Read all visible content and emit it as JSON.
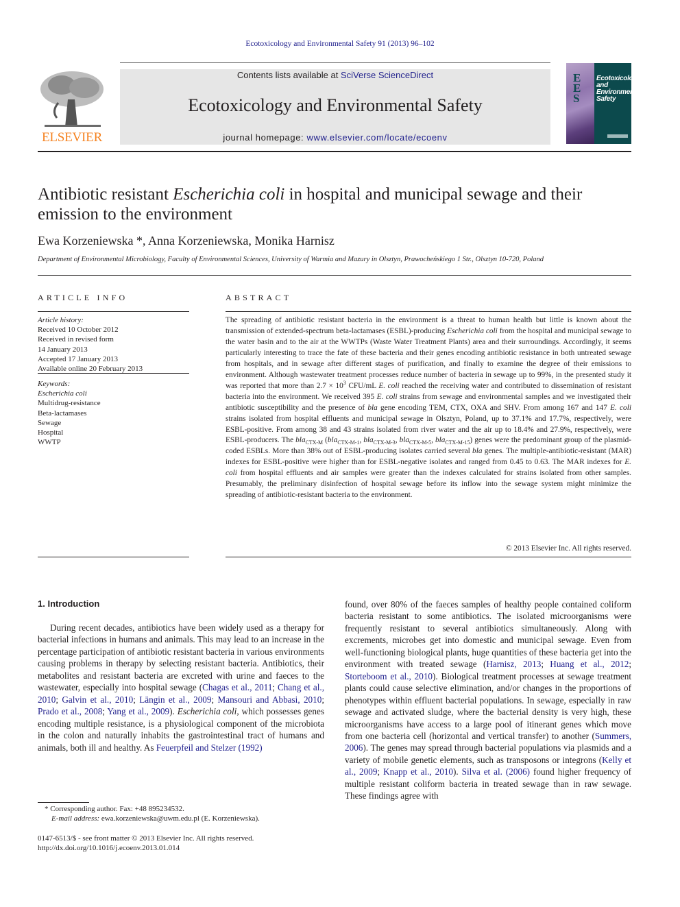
{
  "running_head": "Ecotoxicology and Environmental Safety 91 (2013) 96–102",
  "masthead": {
    "publisher_logo": "ELSEVIER",
    "contents_prefix": "Contents lists available at ",
    "contents_link": "SciVerse ScienceDirect",
    "journal_title": "Ecotoxicology and Environmental Safety",
    "homepage_prefix": "journal homepage: ",
    "homepage_link": "www.elsevier.com/locate/ecoenv",
    "cover": {
      "letters": [
        "E",
        "E",
        "S"
      ],
      "title_lines": [
        "Ecotoxicology",
        "and",
        "Environmental",
        "Safety"
      ]
    },
    "colors": {
      "link": "#1f1f8c",
      "elsevier_orange": "#f58220",
      "masthead_bg": "#e6e6e6",
      "cover_bg": "#0c4a4d"
    }
  },
  "article": {
    "title_part1": "Antibiotic resistant ",
    "title_italic": "Escherichia coli",
    "title_part2": " in hospital and municipal sewage and their emission to the environment",
    "authors": [
      {
        "name": "Ewa Korzeniewska",
        "mark": "*"
      },
      {
        "name": "Anna Korzeniewska",
        "mark": ""
      },
      {
        "name": "Monika Harnisz",
        "mark": ""
      }
    ],
    "affiliation": "Department of Environmental Microbiology, Faculty of Environmental Sciences, University of Warmia and Mazury in Olsztyn, Prawocheńskiego 1 Str., Olsztyn 10-720, Poland"
  },
  "article_info": {
    "heading": "ARTICLE INFO",
    "history_label": "Article history:",
    "history": [
      "Received 10 October 2012",
      "Received in revised form",
      "14 January 2013",
      "Accepted 17 January 2013",
      "Available online 20 February 2013"
    ],
    "keywords_label": "Keywords:",
    "keywords": [
      "Escherichia coli",
      "Multidrug-resistance",
      "Beta-lactamases",
      "Sewage",
      "Hospital",
      "WWTP"
    ]
  },
  "abstract": {
    "heading": "ABSTRACT",
    "t1": "The spreading of antibiotic resistant bacteria in the environment is a threat to human health but little is known about the transmission of extended-spectrum beta-lactamases (ESBL)-producing ",
    "i1": "Escherichia coli",
    "t2": " from the hospital and municipal sewage to the water basin and to the air at the WWTPs (Waste Water Treatment Plants) area and their surroundings. Accordingly, it seems particularly interesting to trace the fate of these bacteria and their genes encoding antibiotic resistance in both untreated sewage from hospitals, and in sewage after different stages of purification, and finally to examine the degree of their emissions to environment. Although wastewater treatment processes reduce number of bacteria in sewage up to 99%, in the presented study it was reported that more than 2.7 × 10",
    "sup1": "3",
    "t3": " CFU/mL ",
    "i2": "E. coli",
    "t4": " reached the receiving water and contributed to dissemination of resistant bacteria into the environment. We received 395 ",
    "i3": "E. coli",
    "t5": " strains from sewage and environmental samples and we investigated their antibiotic susceptibility and the presence of ",
    "i4": "bla",
    "t6": " gene encoding TEM, CTX, OXA and SHV. From among 167 and 147 ",
    "i5": "E. coli",
    "t7": " strains isolated from hospital effluents and municipal sewage in Olsztyn, Poland, up to 37.1% and 17.7%, respectively, were ESBL-positive. From among 38 and 43 strains isolated from river water and the air up to 18.4% and 27.9%, respectively, were ESBL-producers. The ",
    "gene_bla": "bla",
    "sub_m": "CTX-M",
    "t8": " (",
    "sub_m1": "CTX-M-1",
    "sub_m3": "CTX-M-3",
    "sub_m5": "CTX-M-5",
    "sub_m15": "CTX-M-15",
    "sep": ", ",
    "t9": ") genes were the predominant group of the plasmid-coded ESBLs. More than 38% out of ESBL-producing isolates carried several ",
    "t10": " genes. The multiple-antibiotic-resistant (MAR) indexes for ESBL-positive were higher than for ESBL-negative isolates and ranged from 0.45 to 0.63. The MAR indexes for ",
    "i6": "E. coli",
    "t11": " from hospital effluents and air samples were greater than the indexes calculated for strains isolated from other samples. Presumably, the preliminary disinfection of hospital sewage before its inflow into the sewage system might minimize the spreading of antibiotic-resistant bacteria to the environment.",
    "copyright": "© 2013 Elsevier Inc. All rights reserved."
  },
  "introduction": {
    "heading": "1.  Introduction",
    "left": {
      "p1": "During recent decades, antibiotics have been widely used as a therapy for bacterial infections in humans and animals. This may lead to an increase in the percentage participation of antibiotic resistant bacteria in various environments causing problems in therapy by selecting resistant bacteria. Antibiotics, their metabolites and resistant bacteria are excreted with urine and faeces to the wastewater, especially into hospital sewage (",
      "c1": "Chagas et al., 2011",
      "c2": "Chang et al., 2010",
      "c3": "Galvin et al., 2010",
      "c4": "Längin et al., 2009",
      "c5": "Mansouri and Abbasi, 2010",
      "c6": "Prado et al., 2008",
      "c7": "Yang et al., 2009",
      "semi": "; ",
      "p2": "). ",
      "i1": "Escherichia coli",
      "p3": ", which possesses genes encoding multiple resistance, is a physiological component of the microbiota in the colon and naturally inhabits the gastrointestinal tract of humans and animals, both ill and healthy. As ",
      "c8": "Feuerpfeil and Stelzer (1992)"
    },
    "right": {
      "p1": "found, over 80% of the faeces samples of healthy people contained coliform bacteria resistant to some antibiotics. The isolated microorganisms were frequently resistant to several antibiotics simultaneously. Along with excrements, microbes get into domestic and municipal sewage. Even from well-functioning biological plants, huge quantities of these bacteria get into the environment with treated sewage (",
      "c1": "Harnisz, 2013",
      "c2": "Huang et al., 2012",
      "c3": "Storteboom et al., 2010",
      "semi": "; ",
      "p2": "). Biological treatment processes at sewage treatment plants could cause selective elimination, and/or changes in the proportions of phenotypes within effluent bacterial populations. In sewage, especially in raw sewage and activated sludge, where the bacterial density is very high, these microorganisms have access to a large pool of itinerant genes which move from one bacteria cell (horizontal and vertical transfer) to another (",
      "c4": "Summers, 2006",
      "p3": "). The genes may spread through bacterial populations via plasmids and a variety of mobile genetic elements, such as transposons or integrons (",
      "c5": "Kelly et al., 2009",
      "c6": "Knapp et al., 2010",
      "p4": "). ",
      "c7": "Silva et al. (2006)",
      "p5": " found higher frequency of multiple resistant coliform bacteria in treated sewage than in raw sewage. These findings agree with"
    }
  },
  "footnotes": {
    "corresponding": "* Corresponding author. Fax: +48 895234532.",
    "email_label": "E-mail address:",
    "email": " ewa.korzeniewska@uwm.edu.pl (E. Korzeniewska).",
    "front_matter": "0147-6513/$ - see front matter © 2013 Elsevier Inc. All rights reserved.",
    "doi": "http://dx.doi.org/10.1016/j.ecoenv.2013.01.014"
  }
}
